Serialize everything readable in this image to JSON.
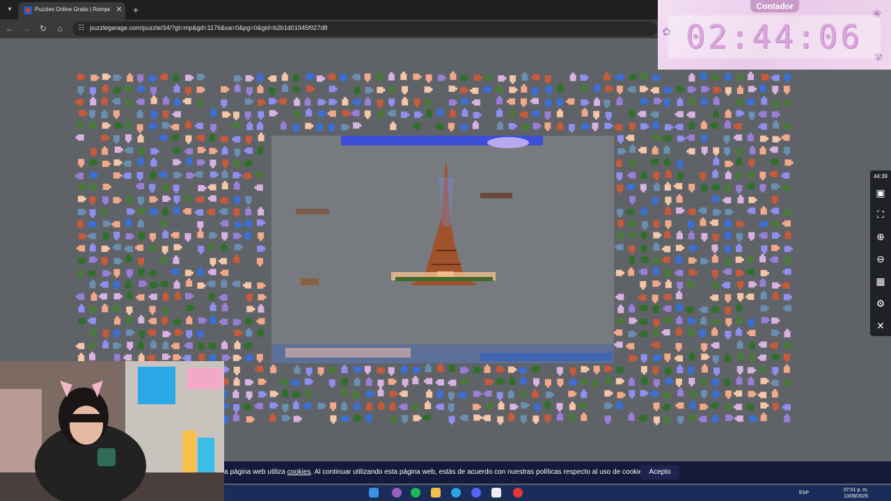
{
  "browser": {
    "tab_title": "Puzzles Online Gratis | Rompecabezas",
    "tab_close": "✕",
    "new_tab": "+",
    "url": "puzzlegarage.com/puzzle/34/?gt=mp&gd=1176&oa=0&pg=0&gid=b2b1d01945f027d8"
  },
  "contador": {
    "title": "Contador",
    "time": "02:44:06"
  },
  "side_tools": {
    "timer": "44:39",
    "icons": [
      "image-icon",
      "fullscreen-icon",
      "zoom-in-icon",
      "zoom-out-icon",
      "grid-icon",
      "settings-icon",
      "close-icon"
    ]
  },
  "cookie": {
    "text_before": "a página web utiliza ",
    "link": "cookies",
    "text_after": ". Al continuar utilizando esta página web, estás de acuerdo con nuestras políticas respecto al uso de cookies.",
    "button": "Acepto"
  },
  "taskbar": {
    "lang": "ESP",
    "time": "07:01 p. m.",
    "date": "13/08/2025"
  },
  "colors": {
    "piece_palette": [
      "#f2a98a",
      "#8f8ff0",
      "#3a6fd8",
      "#2f6f2a",
      "#d8b3e0",
      "#c75a3a",
      "#6b8fb0",
      "#f5c6a8",
      "#4a7a3a",
      "#9a7fd6"
    ]
  }
}
